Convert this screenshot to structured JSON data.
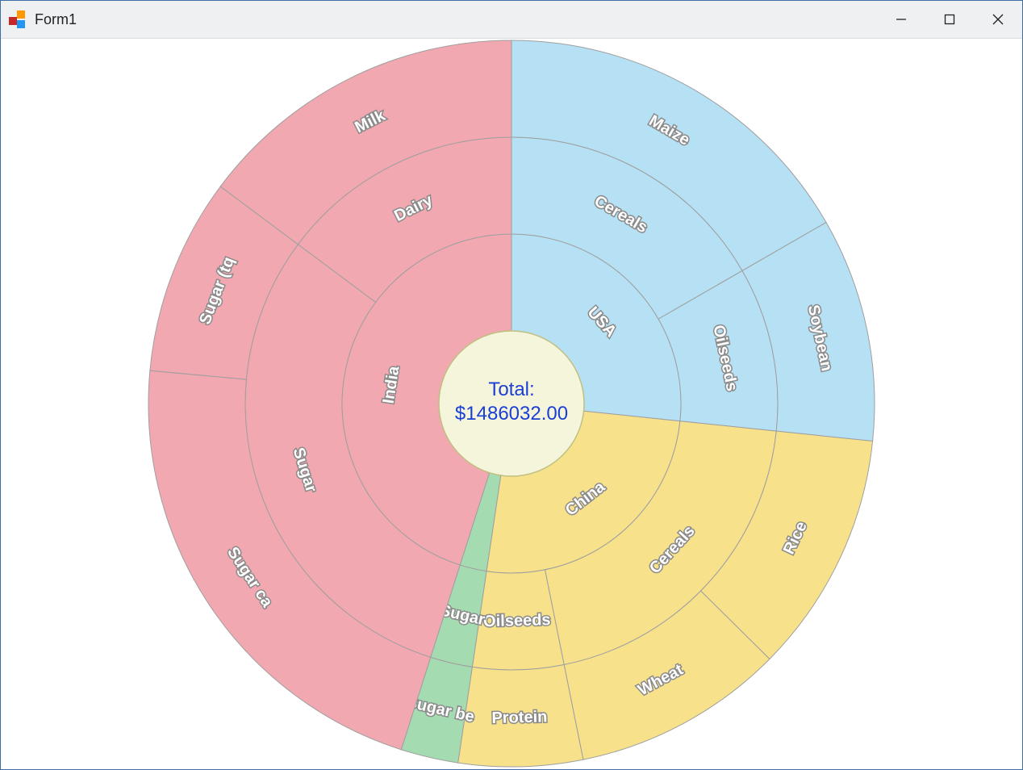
{
  "window": {
    "title": "Form1"
  },
  "center": {
    "label": "Total:",
    "value": "$1486032.00"
  },
  "colors": {
    "USA": {
      "fill": "#b6e0f3",
      "stroke": "#7fb6cc"
    },
    "China": {
      "fill": "#f7e28b",
      "stroke": "#cbb45f"
    },
    "France": {
      "fill": "#a5dbb1",
      "stroke": "#7fb48b"
    },
    "India": {
      "fill": "#f2a8b0",
      "stroke": "#d0818b"
    }
  },
  "labels": {
    "usa": "USA",
    "china": "China",
    "france": "",
    "india": "India",
    "usa_cereals": "Cereals",
    "usa_oilseeds": "Oilseeds",
    "china_cereals": "Cereals",
    "china_oilseeds": "Oilseeds",
    "france_sugar": "Sugar",
    "india_sugar": "Sugar",
    "india_dairy": "Dairy",
    "maize": "Maize",
    "soybean": "Soybean",
    "rice": "Rice",
    "wheat": "Wheat",
    "protein": "Protein",
    "sugar_be": "Sugar be",
    "sugar_ca": "Sugar ca",
    "sugar_tq": "Sugar (tq",
    "milk": "Milk"
  },
  "chart_data": {
    "type": "sunburst",
    "total": 1486032.0,
    "unit": "$",
    "rings": 3,
    "tree": [
      {
        "name": "USA",
        "color": "#b6e0f3",
        "children": [
          {
            "name": "Cereals",
            "children": [
              {
                "name": "Maize",
                "value": 248000
              }
            ]
          },
          {
            "name": "Oilseeds",
            "children": [
              {
                "name": "Soybean",
                "value": 148000
              }
            ]
          }
        ]
      },
      {
        "name": "China",
        "color": "#f7e28b",
        "children": [
          {
            "name": "Cereals",
            "children": [
              {
                "name": "Rice",
                "value": 160000
              },
              {
                "name": "Wheat",
                "value": 140000
              }
            ]
          },
          {
            "name": "Oilseeds",
            "children": [
              {
                "name": "Protein",
                "value": 82000
              }
            ]
          }
        ]
      },
      {
        "name": "France",
        "color": "#a5dbb1",
        "children": [
          {
            "name": "Sugar",
            "children": [
              {
                "name": "Sugar beet",
                "display": "Sugar be",
                "value": 38032
              }
            ]
          }
        ]
      },
      {
        "name": "India",
        "color": "#f2a8b0",
        "children": [
          {
            "name": "Sugar",
            "children": [
              {
                "name": "Sugar cane",
                "display": "Sugar ca",
                "value": 320000
              },
              {
                "name": "Sugar (tq)",
                "display": "Sugar (tq",
                "value": 130000
              }
            ]
          },
          {
            "name": "Dairy",
            "children": [
              {
                "name": "Milk",
                "value": 220000
              }
            ]
          }
        ]
      }
    ]
  }
}
